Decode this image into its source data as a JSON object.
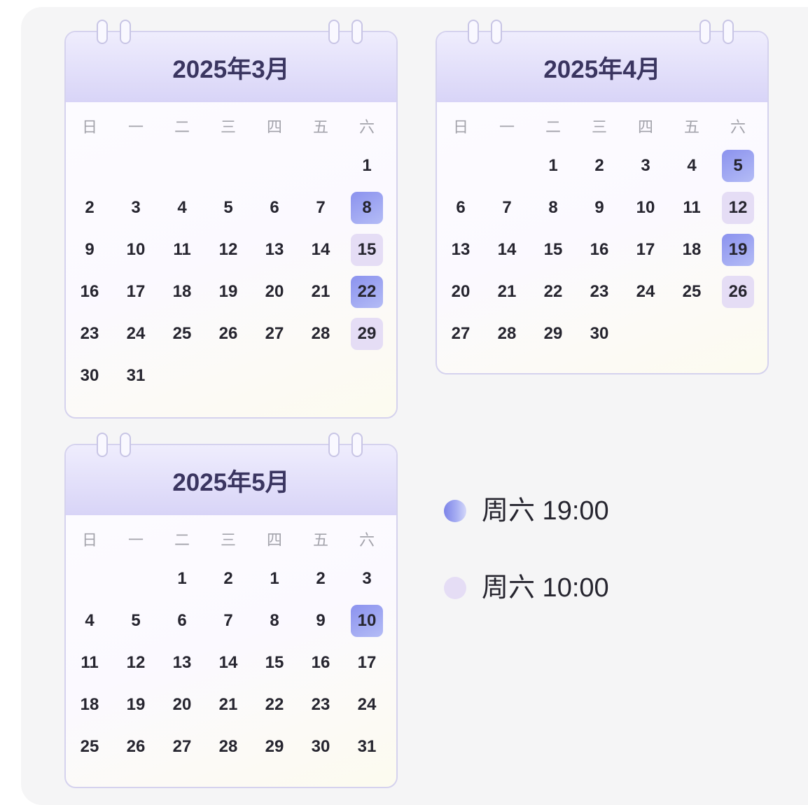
{
  "weekdays": [
    "日",
    "一",
    "二",
    "三",
    "四",
    "五",
    "六"
  ],
  "calendars": [
    {
      "title": "2025年3月",
      "weeks": [
        [
          "",
          "",
          "",
          "",
          "",
          "",
          "1"
        ],
        [
          "2",
          "3",
          "4",
          "5",
          "6",
          "7",
          "8"
        ],
        [
          "9",
          "10",
          "11",
          "12",
          "13",
          "14",
          "15"
        ],
        [
          "16",
          "17",
          "18",
          "19",
          "20",
          "21",
          "22"
        ],
        [
          "23",
          "24",
          "25",
          "26",
          "27",
          "28",
          "29"
        ],
        [
          "30",
          "31",
          "",
          "",
          "",
          "",
          ""
        ]
      ],
      "highlights": {
        "8": "dark",
        "15": "light",
        "22": "dark",
        "29": "light"
      }
    },
    {
      "title": "2025年4月",
      "weeks": [
        [
          "",
          "",
          "1",
          "2",
          "3",
          "4",
          "5"
        ],
        [
          "6",
          "7",
          "8",
          "9",
          "10",
          "11",
          "12"
        ],
        [
          "13",
          "14",
          "15",
          "16",
          "17",
          "18",
          "19"
        ],
        [
          "20",
          "21",
          "22",
          "23",
          "24",
          "25",
          "26"
        ],
        [
          "27",
          "28",
          "29",
          "30",
          "",
          "",
          ""
        ]
      ],
      "highlights": {
        "5": "dark",
        "12": "light",
        "19": "dark",
        "26": "light"
      }
    },
    {
      "title": "2025年5月",
      "weeks": [
        [
          "",
          "",
          "1",
          "2",
          "1",
          "2",
          "3"
        ],
        [
          "4",
          "5",
          "6",
          "7",
          "8",
          "9",
          "10"
        ],
        [
          "11",
          "12",
          "13",
          "14",
          "15",
          "16",
          "17"
        ],
        [
          "18",
          "19",
          "20",
          "21",
          "22",
          "23",
          "24"
        ],
        [
          "25",
          "26",
          "27",
          "28",
          "29",
          "30",
          "31"
        ]
      ],
      "highlights": {
        "10": "dark"
      }
    }
  ],
  "legend": [
    {
      "marker": "dark",
      "label": "周六 19:00"
    },
    {
      "marker": "light",
      "label": "周六 10:00"
    }
  ],
  "colors": {
    "accent_dark": "#8b92ee",
    "accent_dark_end": "#b4bcf6",
    "accent_light": "#e5ddf5",
    "header_top": "#efedfd",
    "header_bottom": "#d8d4f7",
    "card_border": "#d5d2ee",
    "text": "#26252f",
    "weekday": "#a3a3ab",
    "title": "#3a3560",
    "panel": "#f5f5f6"
  }
}
